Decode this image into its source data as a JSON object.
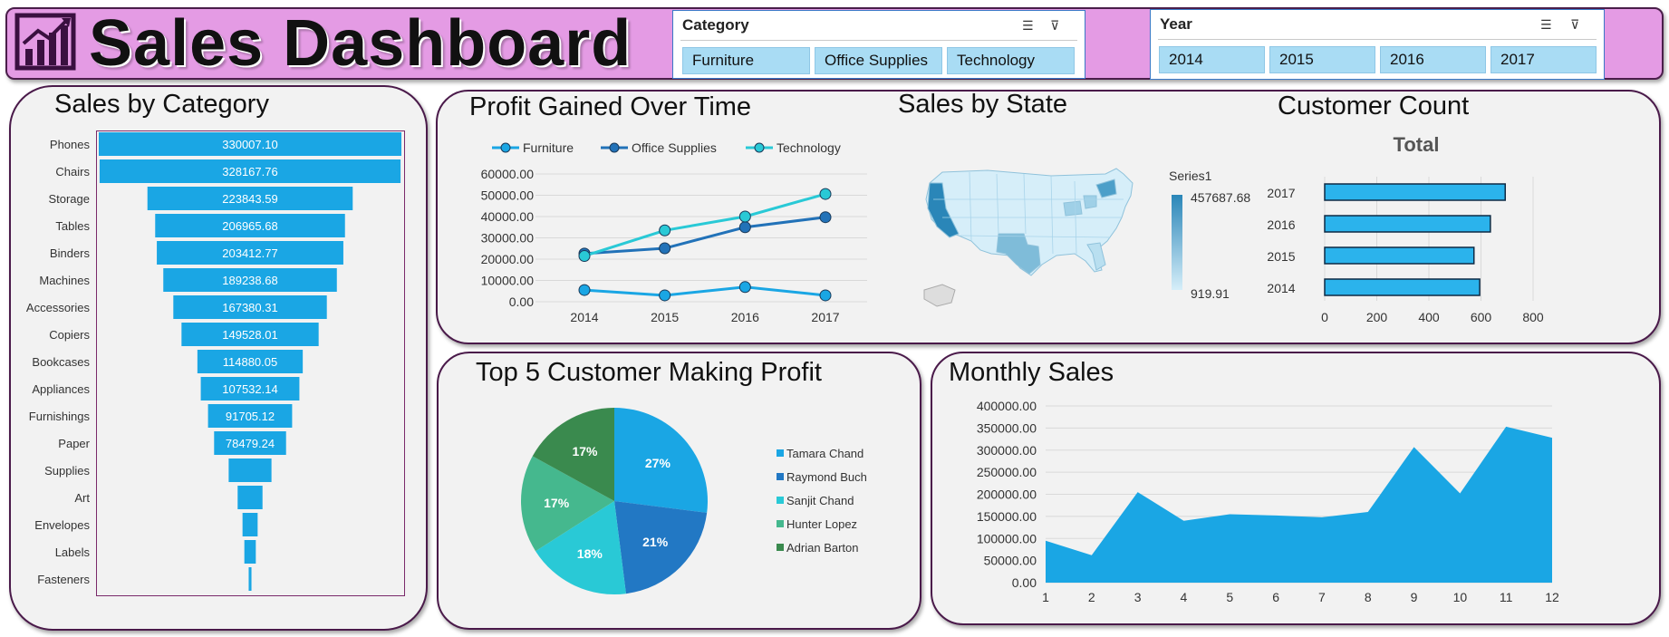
{
  "header": {
    "title": "Sales Dashboard"
  },
  "slicers": {
    "category": {
      "title": "Category",
      "items": [
        "Furniture",
        "Office Supplies",
        "Technology"
      ]
    },
    "year": {
      "title": "Year",
      "items": [
        "2014",
        "2015",
        "2016",
        "2017"
      ]
    }
  },
  "panels": {
    "sales_by_category": "Sales by Category",
    "profit_over_time": "Profit Gained Over Time",
    "sales_by_state": "Sales by State",
    "customer_count": "Customer Count",
    "top5": "Top 5 Customer Making Profit",
    "monthly": "Monthly Sales"
  },
  "map": {
    "legend_title": "Series1",
    "max_label": "457687.68",
    "min_label": "919.91",
    "low_color": "#d6eef9",
    "high_color": "#2a86b8"
  },
  "colors": {
    "bar": "#1aa6e4",
    "furniture": "#1aa6e4",
    "office": "#2272b8",
    "technology": "#29c9d6",
    "area": "#1aa6e4"
  },
  "chart_data": [
    {
      "id": "sales_by_category",
      "type": "bar",
      "title": "Sales by Category",
      "categories": [
        "Phones",
        "Chairs",
        "Storage",
        "Tables",
        "Binders",
        "Machines",
        "Accessories",
        "Copiers",
        "Bookcases",
        "Appliances",
        "Furnishings",
        "Paper",
        "Supplies",
        "Art",
        "Envelopes",
        "Labels",
        "Fasteners"
      ],
      "values": [
        330007.1,
        328167.76,
        223843.59,
        206965.68,
        203412.77,
        189238.68,
        167380.31,
        149528.01,
        114880.05,
        107532.14,
        91705.12,
        78479.24,
        46673.54,
        27118.79,
        16476.4,
        12486.31,
        3024.28
      ],
      "value_labels": [
        "330007.10",
        "328167.76",
        "223843.59",
        "206965.68",
        "203412.77",
        "189238.68",
        "167380.31",
        "149528.01",
        "114880.05",
        "107532.14",
        "91705.12",
        "78479.24",
        "",
        "",
        "",
        "",
        ""
      ]
    },
    {
      "id": "profit_over_time",
      "type": "line",
      "title": "Profit Gained Over Time",
      "x": [
        "2014",
        "2015",
        "2016",
        "2017"
      ],
      "series": [
        {
          "name": "Furniture",
          "values": [
            5500,
            3000,
            6900,
            3000
          ]
        },
        {
          "name": "Office Supplies",
          "values": [
            22600,
            25100,
            35000,
            39700
          ]
        },
        {
          "name": "Technology",
          "values": [
            21500,
            33500,
            40000,
            50600
          ]
        }
      ],
      "yticks": [
        "0.00",
        "10000.00",
        "20000.00",
        "30000.00",
        "40000.00",
        "50000.00",
        "60000.00"
      ],
      "ylim": [
        0,
        60000
      ],
      "legend": "top"
    },
    {
      "id": "customer_count",
      "type": "bar",
      "title": "Total",
      "categories": [
        "2017",
        "2016",
        "2015",
        "2014"
      ],
      "values": [
        693,
        636,
        573,
        595
      ],
      "xticks": [
        "0",
        "200",
        "400",
        "600",
        "800"
      ],
      "xlim": [
        0,
        800
      ]
    },
    {
      "id": "top5",
      "type": "pie",
      "labels": [
        "Tamara Chand",
        "Raymond Buch",
        "Sanjit Chand",
        "Hunter Lopez",
        "Adrian Barton"
      ],
      "values": [
        27,
        21,
        18,
        17,
        17
      ],
      "value_labels": [
        "27%",
        "21%",
        "18%",
        "17%",
        "17%"
      ],
      "colors": [
        "#1aa6e4",
        "#2278c4",
        "#29c9d6",
        "#45b88e",
        "#3a8a4e"
      ]
    },
    {
      "id": "monthly",
      "type": "area",
      "x": [
        "1",
        "2",
        "3",
        "4",
        "5",
        "6",
        "7",
        "8",
        "9",
        "10",
        "11",
        "12"
      ],
      "values": [
        95000,
        62000,
        205000,
        140000,
        155000,
        152000,
        148000,
        160000,
        307000,
        202000,
        353000,
        328000
      ],
      "yticks": [
        "0.00",
        "50000.00",
        "100000.00",
        "150000.00",
        "200000.00",
        "250000.00",
        "300000.00",
        "350000.00",
        "400000.00"
      ],
      "ylim": [
        0,
        400000
      ]
    }
  ]
}
